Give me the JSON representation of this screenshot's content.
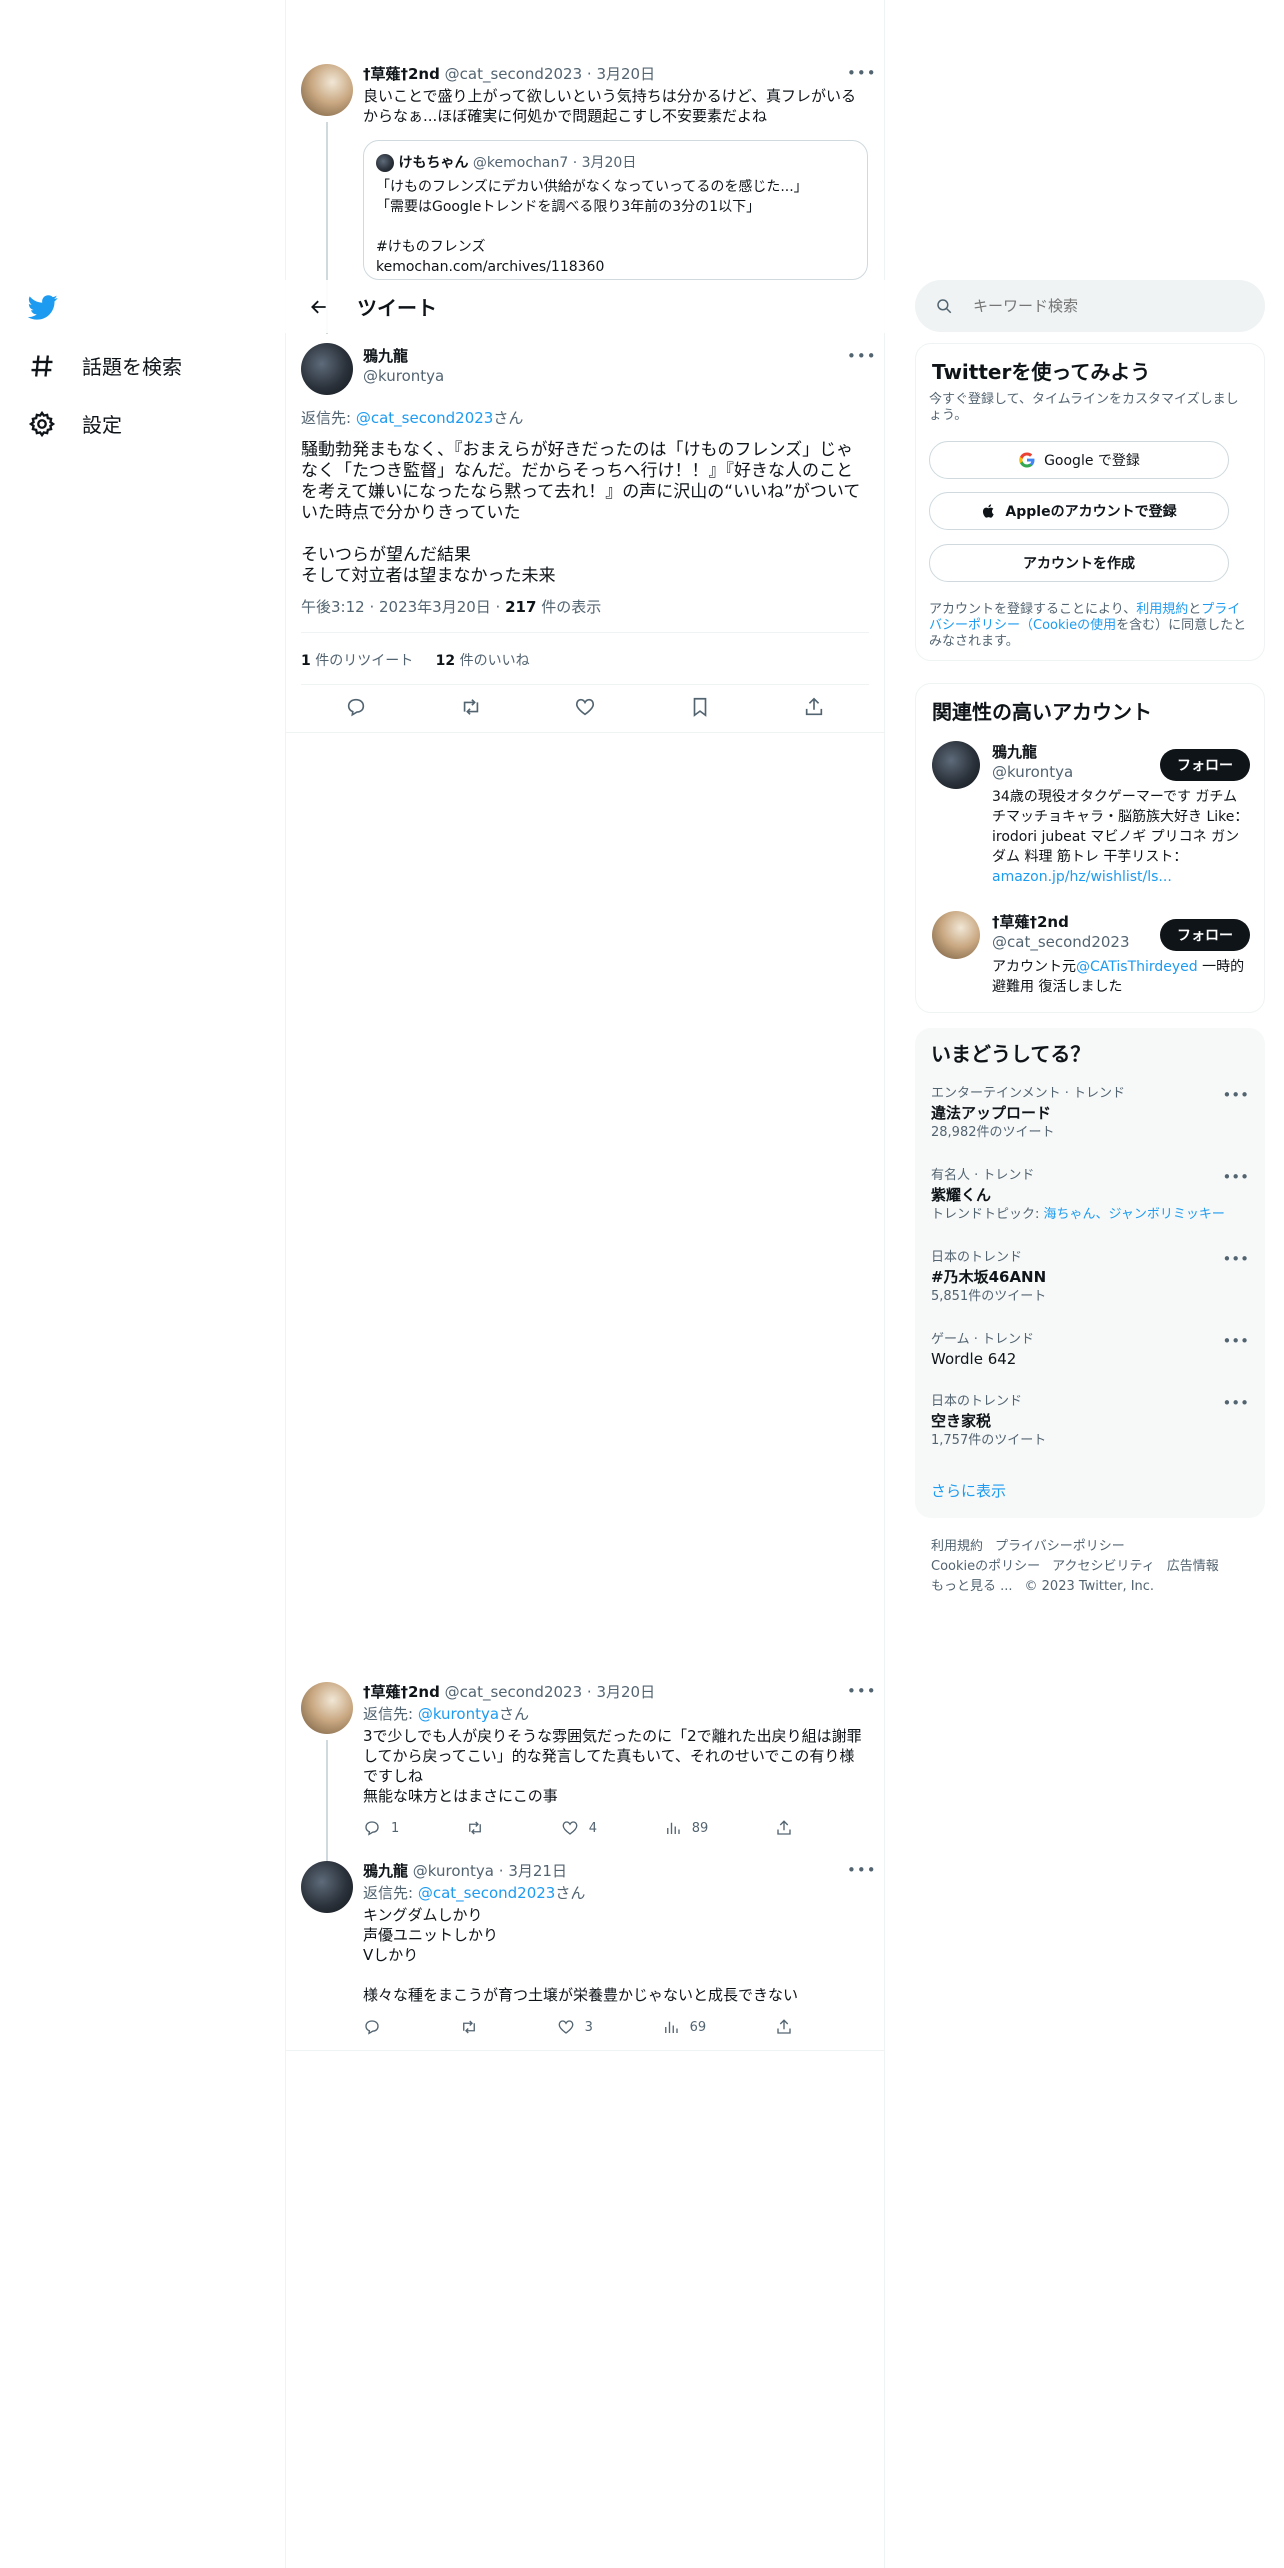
{
  "nav": {
    "explore_label": "話題を検索",
    "settings_label": "設定"
  },
  "top_tweet": {
    "name": "†草薙†2nd",
    "handle": "@cat_second2023",
    "date": "· 3月20日",
    "text": "良いことで盛り上がって欲しいという気持ちは分かるけど、真フレがいるからなぁ...ほぼ確実に何処かで問題起こすし不安要素だよね",
    "quote": {
      "name": "けもちゃん",
      "handle": "@kemochan7",
      "date": "· 3月20日",
      "line1": "「けものフレンズにデカい供給がなくなっていってるのを感じた...」",
      "line2": "「需要はGoogleトレンドを調べる限り3年前の3分の1以下」",
      "line3": "#けものフレンズ",
      "line4": "kemochan.com/archives/118360"
    }
  },
  "header": {
    "title": "ツイート"
  },
  "main_tweet": {
    "name": "鴉九龍",
    "handle": "@kurontya",
    "reply_prefix": "返信先: ",
    "reply_to": "@cat_second2023",
    "reply_suffix": "さん",
    "para1": "騒動勃発まもなく、『おまえらが好きだったのは「けものフレンズ」じゃなく「たつき監督」なんだ。だからそっちへ行け！！』『好きな人のことを考えて嫌いになったなら黙って去れ！』の声に沢山の“いいね”がついていた時点で分かりきっていた",
    "para2a": "そいつらが望んだ結果",
    "para2b": "そして対立者は望まなかった未来",
    "time": "午後3:12 · 2023年3月20日 · ",
    "views": "217",
    "views_label": " 件の表示",
    "retweets": "1",
    "retweets_label": " 件のリツイート",
    "likes": "12",
    "likes_label": " 件のいいね"
  },
  "reply1": {
    "name": "†草薙†2nd",
    "handle": "@cat_second2023",
    "date": "· 3月20日",
    "reply_prefix": "返信先: ",
    "reply_to": "@kurontya",
    "reply_suffix": "さん",
    "text1": "3で少しでも人が戻りそうな雰囲気だったのに「2で離れた出戻り組は謝罪してから戻ってこい」的な発言してた真もいて、それのせいでこの有り様ですしね",
    "text2": "無能な味方とはまさにこの事",
    "replies": "1",
    "retweets": "",
    "likes": "4",
    "views": "89"
  },
  "reply2": {
    "name": "鴉九龍",
    "handle": "@kurontya",
    "date": "· 3月21日",
    "reply_prefix": "返信先: ",
    "reply_to": "@cat_second2023",
    "reply_suffix": "さん",
    "l1": "キングダムしかり",
    "l2": "声優ユニットしかり",
    "l3": "Vしかり",
    "l4": "様々な種をまこうが育つ土壌が栄養豊かじゃないと成長できない",
    "replies": "",
    "retweets": "",
    "likes": "3",
    "views": "69"
  },
  "search": {
    "placeholder": "キーワード検索"
  },
  "signup": {
    "title": "Twitterを使ってみよう",
    "desc": "今すぐ登録して、タイムラインをカスタマイズしましょう。",
    "google_btn": "Google で登録",
    "apple_btn": "Appleのアカウントで登録",
    "create_btn": "アカウントを作成",
    "terms_1": "アカウントを登録することにより、",
    "terms_link1": "利用規約",
    "terms_2": "と",
    "terms_link2": "プライバシーポリシー（Cookieの使用",
    "terms_3": "を含む）に同意したとみなされます。"
  },
  "relevant": {
    "title": "関連性の高いアカウント",
    "follow_label": "フォロー",
    "accounts": [
      {
        "name": "鴉九龍",
        "handle": "@kurontya",
        "bio": "34歳の現役オタクゲーマーです ガチムチマッチョキャラ・脳筋族大好き Like： irodori jubeat マビノギ プリコネ ガンダム 料理 筋トレ 干芋リスト：",
        "bio_link": "amazon.jp/hz/wishlist/ls..."
      },
      {
        "name": "†草薙†2nd",
        "handle": "@cat_second2023",
        "bio_1": "アカウント元",
        "bio_link": "@CATisThirdeyed",
        "bio_2": " 一時的避難用 復活しました"
      }
    ]
  },
  "trends": {
    "title": "いまどうしてる？",
    "items": [
      {
        "category": "エンターテインメント · トレンド",
        "name": "違法アップロード",
        "count": "28,982件のツイート"
      },
      {
        "category": "有名人 · トレンド",
        "name": "紫耀くん",
        "count_prefix": "トレンドトピック: ",
        "count_link": "海ちゃん、ジャンボリミッキー"
      },
      {
        "category": "日本のトレンド",
        "name": "#乃木坂46ANN",
        "count": "5,851件のツイート"
      },
      {
        "category": "ゲーム · トレンド",
        "name": "Wordle 642",
        "count": ""
      },
      {
        "category": "日本のトレンド",
        "name": "空き家税",
        "count": "1,757件のツイート"
      }
    ],
    "show_more": "さらに表示"
  },
  "footer": {
    "terms": "利用規約",
    "privacy": "プライバシーポリシー",
    "cookie": "Cookieのポリシー",
    "accessibility": "アクセシビリティ",
    "ads": "広告情報",
    "more": "もっと見る ...",
    "copyright": "© 2023 Twitter, Inc."
  },
  "colors": {
    "accent": "#1d9bf0",
    "text": "#0f1419",
    "muted": "#536471",
    "border": "#eff3f4"
  }
}
